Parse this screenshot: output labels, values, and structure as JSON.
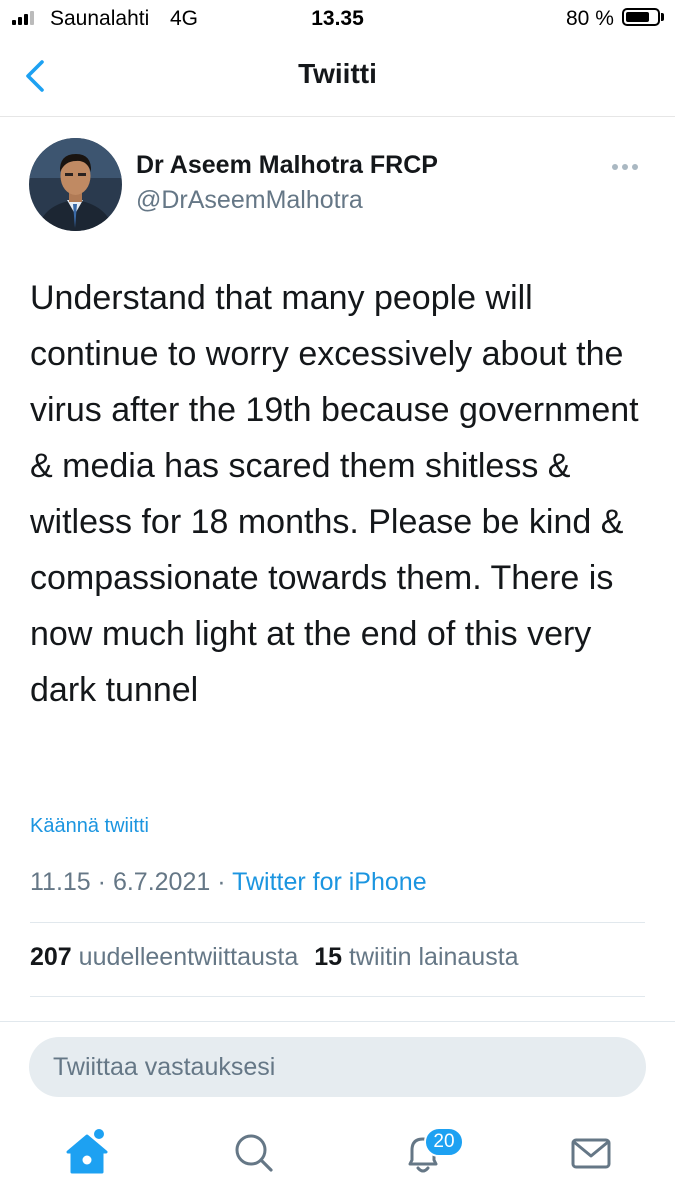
{
  "status_bar": {
    "carrier": "Saunalahti",
    "network": "4G",
    "time": "13.35",
    "battery": "80 %",
    "battery_level": 0.8
  },
  "nav": {
    "title": "Twiitti",
    "back_icon": "chevron-left-icon"
  },
  "tweet": {
    "author_name": "Dr Aseem Malhotra FRCP",
    "author_handle": "@DrAseemMalhotra",
    "text": "Understand that many people will continue to worry excessively about the virus after the 19th because government & media has scared them shitless & witless for 18 months. Please be kind & compassionate towards them. There is now much light at the end of this very dark tunnel",
    "translate_label": "Käännä twiitti",
    "time": "11.15",
    "separator": "·",
    "date": "6.7.2021",
    "source": "Twitter for iPhone",
    "retweets_count": "207",
    "retweets_label": "uudelleentwiittausta",
    "quotes_count": "15",
    "quotes_label": "twiitin lainausta"
  },
  "reply": {
    "placeholder": "Twiittaa vastauksesi"
  },
  "tab_bar": {
    "notifications_badge": "20",
    "icons": [
      "home-icon",
      "search-icon",
      "bell-icon",
      "mail-icon"
    ]
  },
  "colors": {
    "accent": "#1da1f2",
    "link": "#1b95e0",
    "secondary_text": "#657786",
    "reply_bg": "#e6ecf0"
  }
}
